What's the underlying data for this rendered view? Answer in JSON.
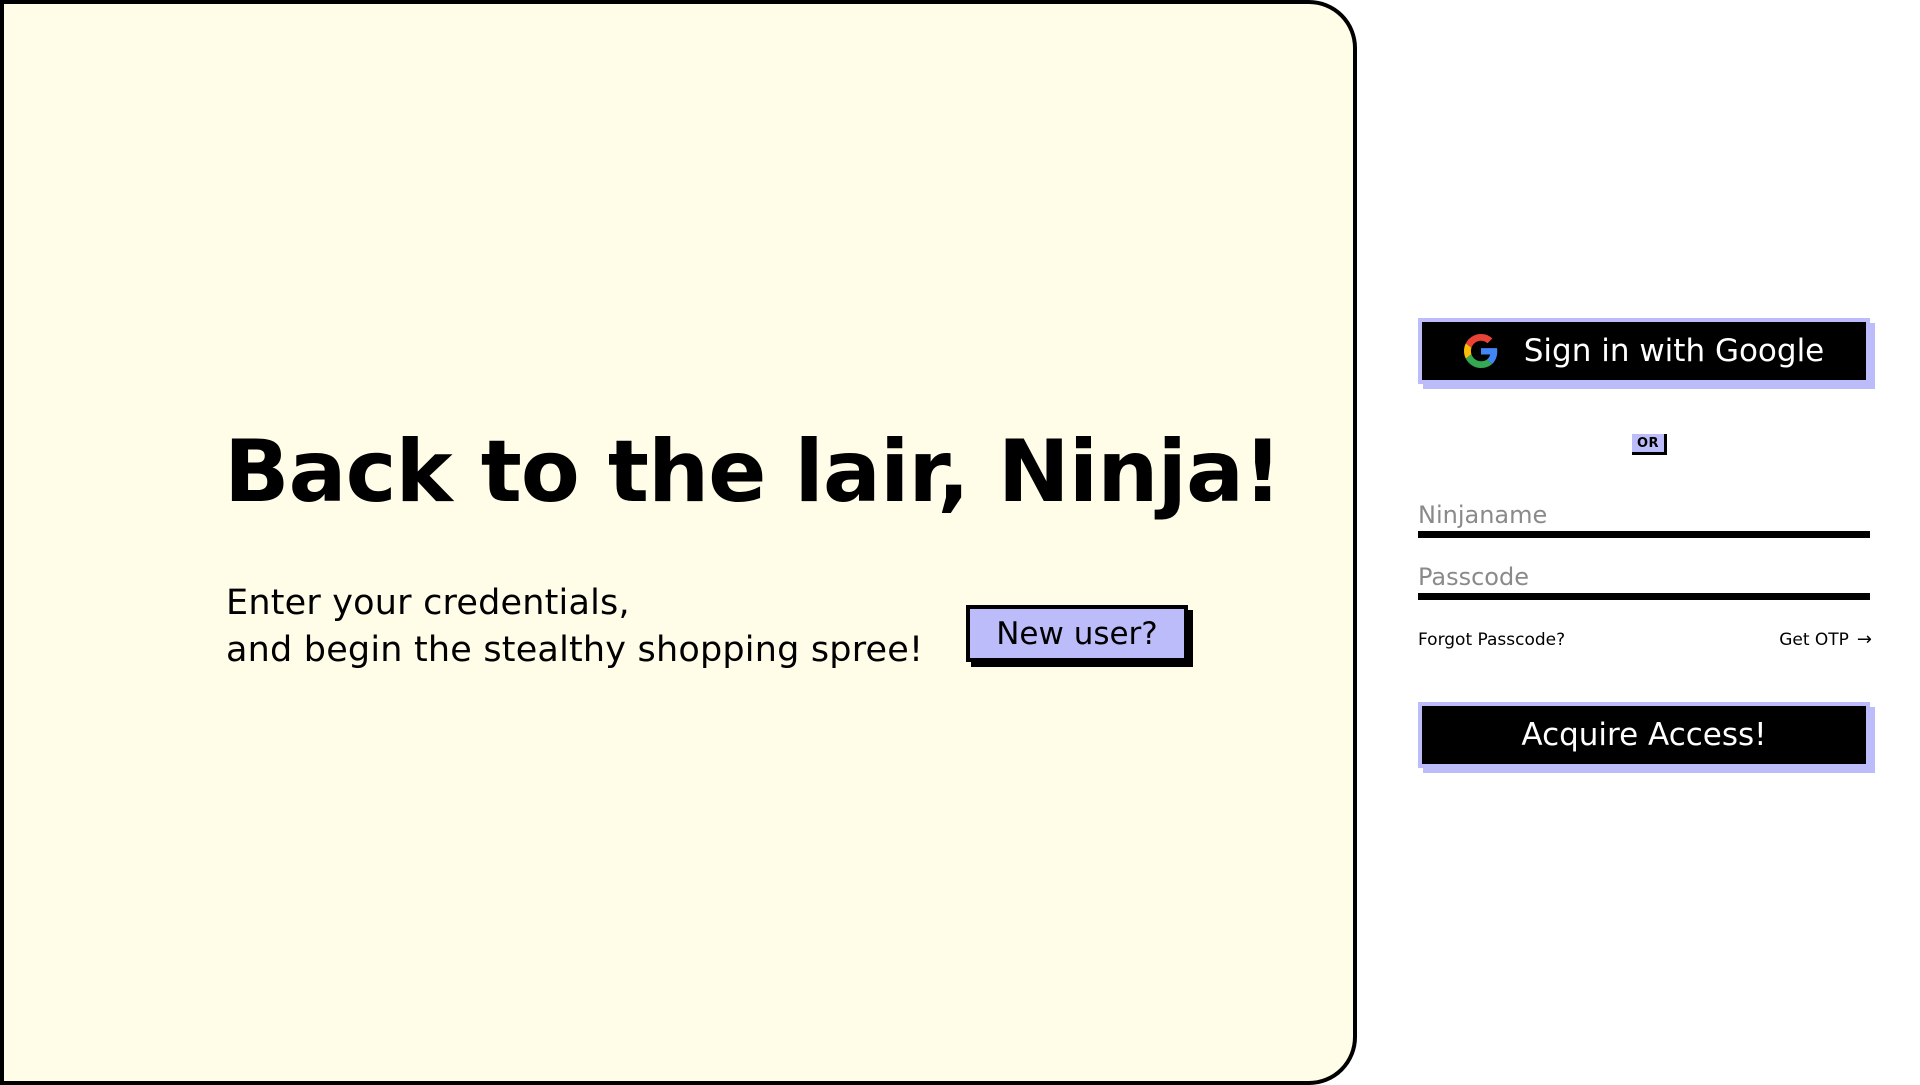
{
  "hero": {
    "title": "Back to the lair, Ninja!",
    "subtitle_line1": "Enter your credentials,",
    "subtitle_line2": "and begin the stealthy shopping spree!",
    "new_user_label": "New user?"
  },
  "login": {
    "google_label": "Sign in with Google",
    "google_icon": "google-g-icon",
    "or_label": "OR",
    "username_placeholder": "Ninjaname",
    "password_placeholder": "Passcode",
    "forgot_label": "Forgot Passcode?",
    "otp_label": "Get OTP",
    "otp_arrow": "→",
    "submit_label": "Acquire Access!"
  },
  "colors": {
    "hero_background": "#fffce8",
    "accent": "#bcbcfa",
    "primary": "#000000"
  }
}
